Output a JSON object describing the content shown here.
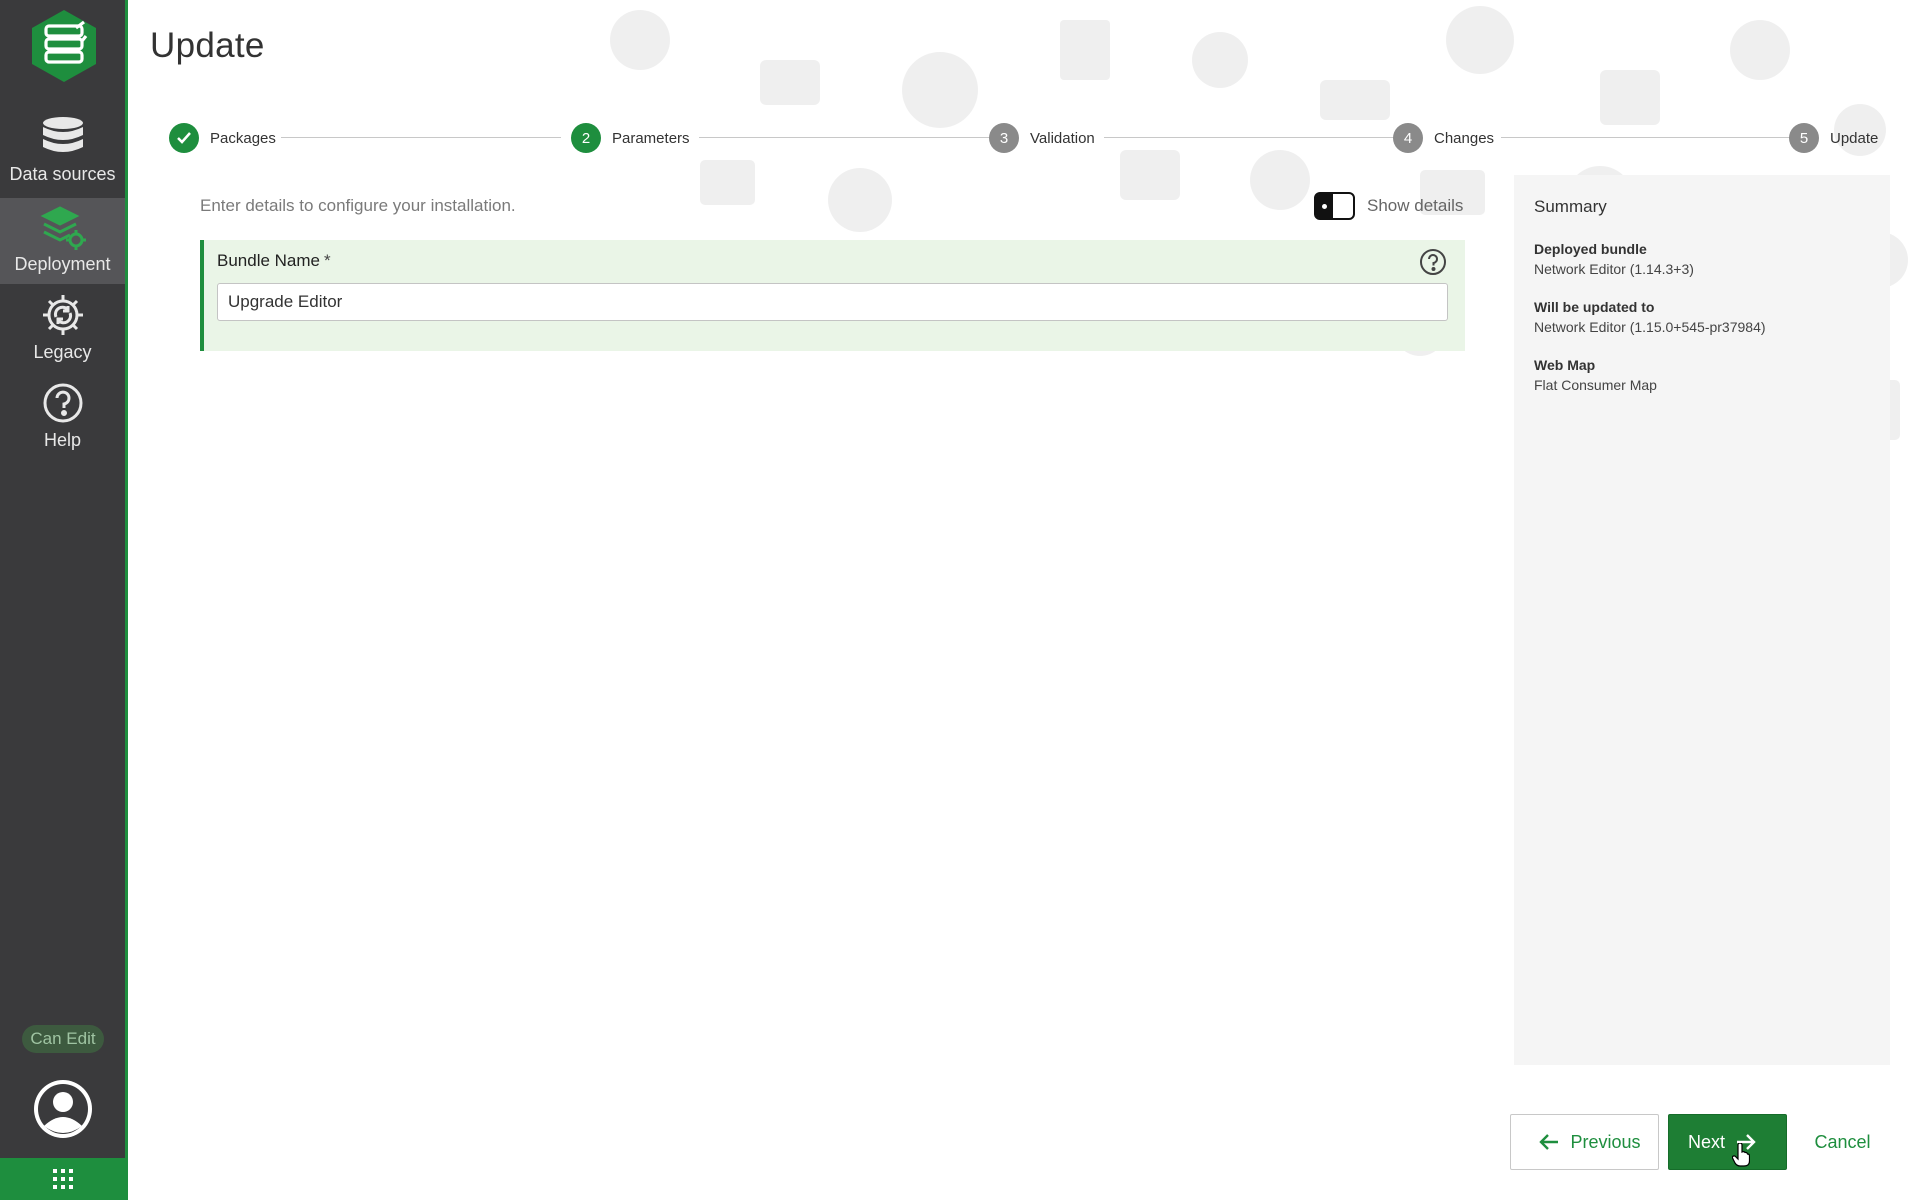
{
  "page": {
    "title": "Update"
  },
  "sidebar": {
    "items": [
      {
        "label": "Data sources",
        "icon": "database-icon"
      },
      {
        "label": "Deployment",
        "icon": "deployment-icon",
        "active": true
      },
      {
        "label": "Legacy",
        "icon": "legacy-gear-icon"
      },
      {
        "label": "Help",
        "icon": "help-icon"
      }
    ],
    "permission_badge": "Can Edit",
    "logo": "app-logo-icon",
    "avatar": "user-avatar-icon",
    "apps": "apps-grid-icon"
  },
  "stepper": {
    "steps": [
      {
        "number": "",
        "label": "Packages",
        "state": "done"
      },
      {
        "number": "2",
        "label": "Parameters",
        "state": "current"
      },
      {
        "number": "3",
        "label": "Validation",
        "state": "pending"
      },
      {
        "number": "4",
        "label": "Changes",
        "state": "pending"
      },
      {
        "number": "5",
        "label": "Update",
        "state": "pending"
      }
    ]
  },
  "form": {
    "intro": "Enter details to configure your installation.",
    "show_details_label": "Show details",
    "bundle_name": {
      "label": "Bundle Name",
      "required_mark": "*",
      "value": "Upgrade Editor"
    }
  },
  "summary": {
    "title": "Summary",
    "items": [
      {
        "key": "Deployed bundle",
        "value": "Network Editor (1.14.3+3)"
      },
      {
        "key": "Will be updated to",
        "value": "Network Editor (1.15.0+545-pr37984)"
      },
      {
        "key": "Web Map",
        "value": "Flat Consumer Map"
      }
    ]
  },
  "actions": {
    "previous": "Previous",
    "next": "Next",
    "cancel": "Cancel"
  },
  "colors": {
    "accent": "#1e8e3e",
    "sidebar_bg": "#3a3a3c",
    "form_bg": "#eaf5e7"
  }
}
